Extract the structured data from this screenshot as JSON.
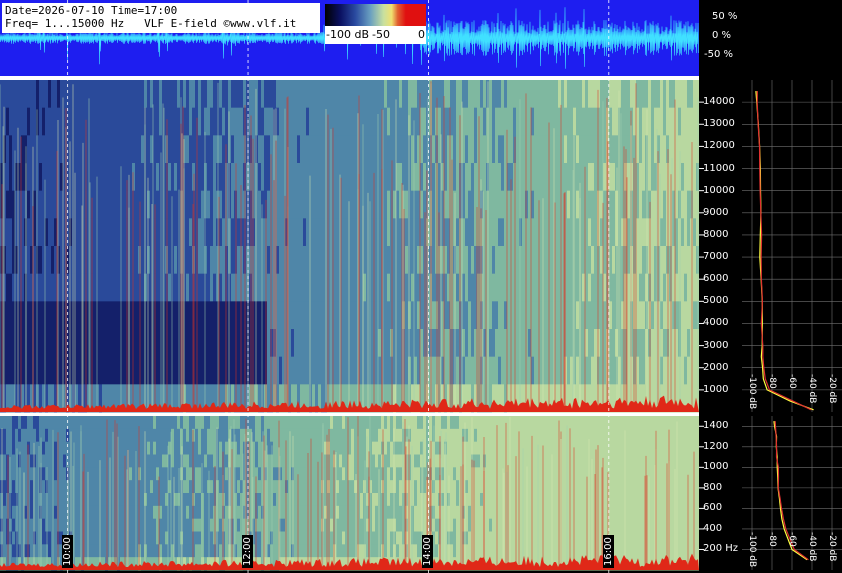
{
  "header": {
    "line1": "Date=2026-07-10 Time=17:00",
    "line2": "Freq= 1...15000 Hz   VLF E-field ©www.vlf.it"
  },
  "colorbar": {
    "labels": [
      "-100 dB",
      "-50",
      "0"
    ]
  },
  "amplitude_axis": {
    "ticks": [
      "50 %",
      "0 %",
      "-50 %"
    ]
  },
  "chart_data": [
    {
      "type": "heatmap",
      "name_in_image": "",
      "description_free": true,
      "x": [
        "10:00",
        "12:00",
        "14:00",
        "16:00"
      ],
      "yticks": [
        "1000",
        "2000",
        "3000",
        "4000",
        "5000",
        "6000",
        "7000",
        "8000",
        "9000",
        "10000",
        "11000",
        "12000",
        "13000",
        "14000"
      ],
      "ylim": [
        0,
        15000
      ],
      "xlim_hours": [
        9.25,
        17.0
      ],
      "grid": true
    },
    {
      "type": "heatmap",
      "x": [
        "10:00",
        "12:00",
        "14:00",
        "16:00"
      ],
      "yticks": [
        "200 Hz",
        "400",
        "600",
        "800",
        "1000",
        "1200",
        "1400"
      ],
      "ylim": [
        0,
        1500
      ],
      "grid": true
    },
    {
      "type": "line",
      "xticks": [
        "-100 dB",
        "-80",
        "-60",
        "-40 dB",
        "-20 dB"
      ],
      "yticks": [
        "1000",
        "2000",
        "3000",
        "4000",
        "5000",
        "6000",
        "7000",
        "8000",
        "9000",
        "10000",
        "11000",
        "12000",
        "13000",
        "14000"
      ],
      "ylim": [
        0,
        15000
      ],
      "series": [
        {
          "x": [
            -96,
            -95,
            -94,
            -93,
            -92,
            -92,
            -91,
            -91,
            -92,
            -91,
            -90,
            -90,
            -90,
            -90,
            -89,
            -88,
            -85,
            -62,
            -38
          ],
          "y": [
            14500,
            14000,
            13000,
            12000,
            11000,
            10000,
            9000,
            8000,
            7000,
            6000,
            5000,
            4000,
            3000,
            2500,
            2000,
            1500,
            1000,
            500,
            100
          ],
          "color": "#ffff40"
        },
        {
          "x": [
            -95,
            -95,
            -94,
            -93,
            -92,
            -92,
            -91,
            -91,
            -91,
            -91,
            -90,
            -90,
            -89,
            -89,
            -88,
            -87,
            -82,
            -60,
            -40
          ],
          "y": [
            14500,
            14000,
            13000,
            12000,
            11000,
            10000,
            9000,
            8000,
            7000,
            6000,
            5000,
            4000,
            3000,
            2500,
            2000,
            1500,
            1000,
            500,
            100
          ],
          "color": "#e03030"
        }
      ]
    },
    {
      "type": "line",
      "xticks": [
        "-100 dB",
        "-80",
        "-60",
        "-40 dB",
        "-20 dB"
      ],
      "yticks": [
        "200 Hz",
        "400",
        "600",
        "800",
        "1000",
        "1200",
        "1400"
      ],
      "ylim": [
        0,
        1500
      ],
      "series": [
        {
          "x": [
            -78,
            -77,
            -76,
            -76,
            -75,
            -75,
            -74,
            -74,
            -73,
            -72,
            -70,
            -68,
            -60,
            -45
          ],
          "y": [
            1450,
            1400,
            1300,
            1200,
            1100,
            1000,
            900,
            800,
            700,
            600,
            500,
            400,
            200,
            100
          ],
          "color": "#ffff40"
        },
        {
          "x": [
            -77,
            -77,
            -76,
            -75,
            -75,
            -74,
            -74,
            -73,
            -72,
            -71,
            -69,
            -66,
            -58,
            -44
          ],
          "y": [
            1450,
            1400,
            1300,
            1200,
            1100,
            1000,
            900,
            800,
            700,
            600,
            500,
            400,
            200,
            100
          ],
          "color": "#e03030"
        }
      ]
    }
  ]
}
